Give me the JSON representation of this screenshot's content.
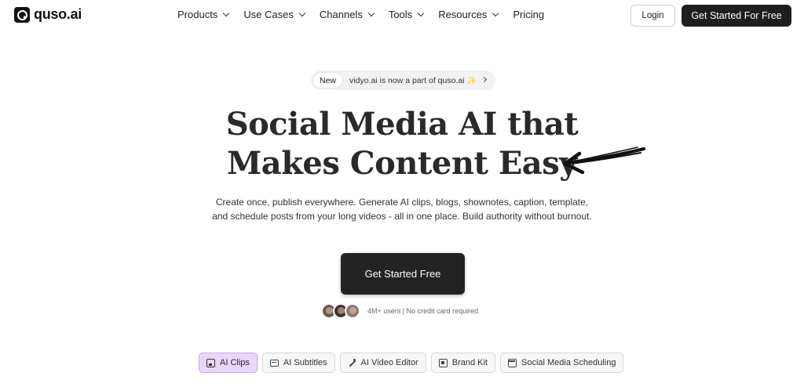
{
  "brand": {
    "name": "quso.ai",
    "logo_icon": "quso-logo-icon"
  },
  "nav": {
    "items": [
      {
        "label": "Products",
        "has_dropdown": true
      },
      {
        "label": "Use Cases",
        "has_dropdown": true
      },
      {
        "label": "Channels",
        "has_dropdown": true
      },
      {
        "label": "Tools",
        "has_dropdown": true
      },
      {
        "label": "Resources",
        "has_dropdown": true
      },
      {
        "label": "Pricing",
        "has_dropdown": false
      }
    ],
    "login_label": "Login",
    "cta_label": "Get Started For Free"
  },
  "announcement": {
    "badge": "New",
    "text": "vidyo.ai is now a part of quso.ai",
    "sparkle": "✨"
  },
  "hero": {
    "headline_line1": "Social Media AI that",
    "headline_line2": "Makes Content Easy",
    "subtext": "Create once, publish everywhere. Generate AI clips, blogs, shownotes, caption, template, and schedule posts from your long videos - all in one place. Build authority without burnout.",
    "cta_label": "Get Started Free",
    "social_proof": "4M+ users | No credit card required"
  },
  "feature_tabs": [
    {
      "label": "AI Clips",
      "icon": "clip-icon",
      "active": true
    },
    {
      "label": "AI Subtitles",
      "icon": "subtitles-icon",
      "active": false
    },
    {
      "label": "AI Video Editor",
      "icon": "magic-wand-icon",
      "active": false
    },
    {
      "label": "Brand Kit",
      "icon": "brand-kit-icon",
      "active": false
    },
    {
      "label": "Social Media Scheduling",
      "icon": "calendar-icon",
      "active": false
    }
  ],
  "colors": {
    "primary_dark": "#1e1e1e",
    "active_tab_bg": "#e9d7fb",
    "active_tab_border": "#c9a8f0",
    "pill_bg": "#f2f2f2"
  }
}
